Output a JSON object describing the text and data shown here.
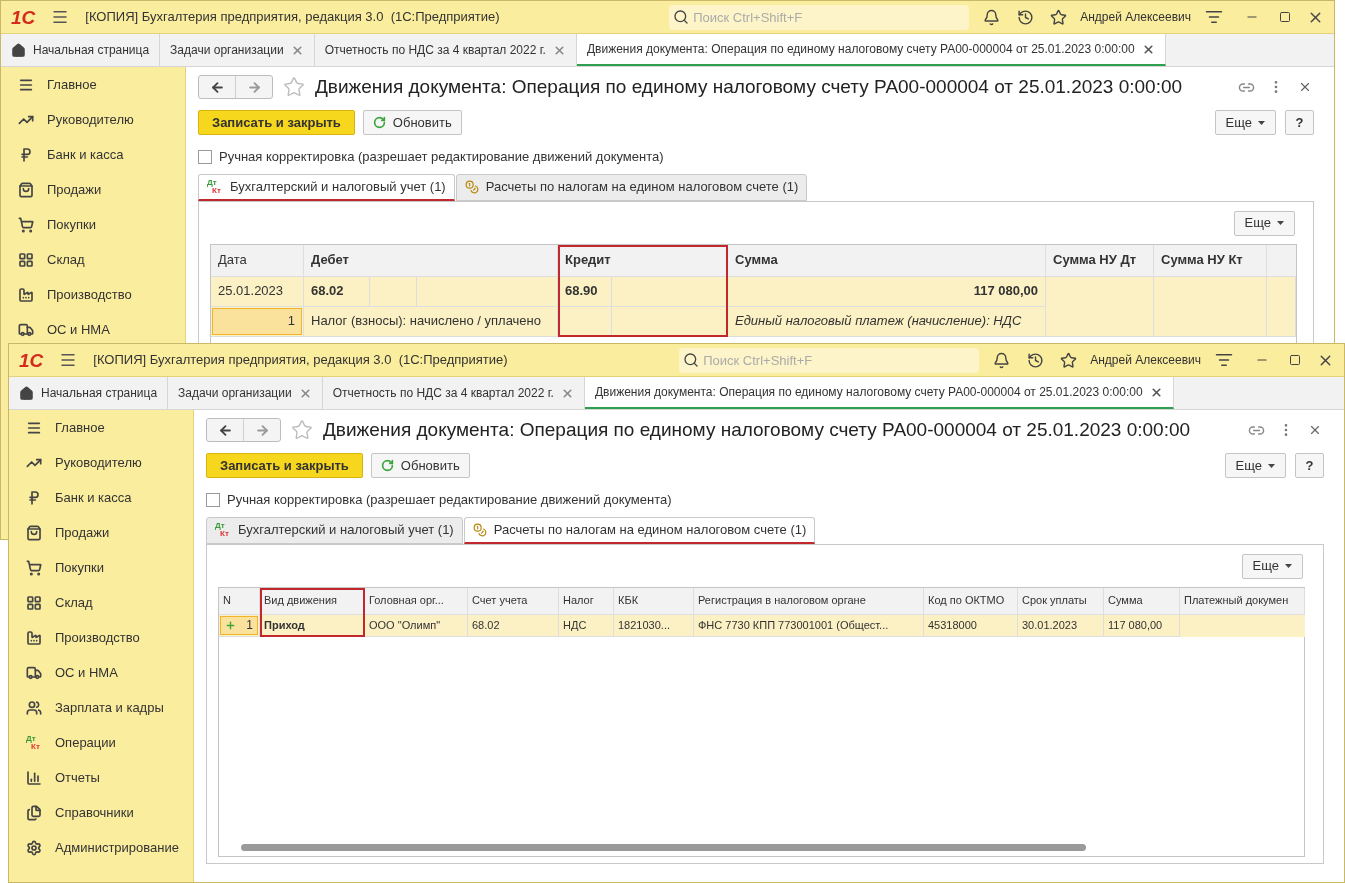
{
  "windows": [
    {
      "logo": "1С",
      "title": "[КОПИЯ] Бухгалтерия предприятия, редакция 3.0  (1С:Предприятие)",
      "search": {
        "placeholder": "Поиск Ctrl+Shift+F"
      },
      "user": "Андрей Алексеевич",
      "tabs": [
        {
          "label": "Начальная страница",
          "kind": "home",
          "selected": false
        },
        {
          "label": "Задачи организации",
          "kind": "page",
          "selected": false
        },
        {
          "label": "Отчетность по НДС за 4 квартал 2022 г.",
          "kind": "page",
          "selected": false
        },
        {
          "label": "Движения документа: Операция по единому налоговому счету РА00-000004 от 25.01.2023 0:00:00",
          "kind": "page",
          "selected": true
        }
      ],
      "sidebar": {
        "items": [
          {
            "label": "Главное"
          },
          {
            "label": "Руководителю"
          },
          {
            "label": "Банк и касса"
          },
          {
            "label": "Продажи"
          },
          {
            "label": "Покупки"
          },
          {
            "label": "Склад"
          },
          {
            "label": "Производство"
          },
          {
            "label": "ОС и НМА"
          }
        ]
      },
      "document": {
        "title": "Движения документа: Операция по единому налоговому счету РА00-000004 от 25.01.2023 0:00:00",
        "save_button": "Записать и закрыть",
        "refresh_button": "Обновить",
        "more_button": "Еще",
        "help_button": "?",
        "manual_edit": {
          "label": "Ручная корректировка (разрешает редактирование движений документа)",
          "checked": false
        },
        "tabs": [
          {
            "label": "Бухгалтерский и налоговый учет (1)",
            "icon_label": [
              "Дт",
              "Кт"
            ],
            "selected": true
          },
          {
            "label": "Расчеты по налогам на едином налоговом счете (1)",
            "selected": false
          }
        ],
        "table": {
          "kind": "entries",
          "more_button": "Еще",
          "columns": [
            {
              "label": "Дата",
              "highlighted": false
            },
            {
              "label": "Дебет",
              "highlighted": false
            },
            {
              "label": "Кредит",
              "highlighted": true
            },
            {
              "label": "Сумма",
              "highlighted": false
            },
            {
              "label": "Сумма НУ Дт",
              "highlighted": false
            },
            {
              "label": "Сумма НУ Кт",
              "highlighted": false
            }
          ],
          "rows": [
            {
              "selected": true,
              "date": "25.01.2023",
              "debit": "68.02",
              "credit": "68.90",
              "amount": "117 080,00",
              "number": "1",
              "content": "Налог (взносы): начислено / уплачено",
              "description": "Единый налоговый платеж (начисление): НДС"
            }
          ]
        }
      }
    },
    {
      "logo": "1С",
      "title": "[КОПИЯ] Бухгалтерия предприятия, редакция 3.0  (1С:Предприятие)",
      "search": {
        "placeholder": "Поиск Ctrl+Shift+F"
      },
      "user": "Андрей Алексеевич",
      "tabs": [
        {
          "label": "Начальная страница",
          "kind": "home",
          "selected": false
        },
        {
          "label": "Задачи организации",
          "kind": "page",
          "selected": false
        },
        {
          "label": "Отчетность по НДС за 4 квартал 2022 г.",
          "kind": "page",
          "selected": false
        },
        {
          "label": "Движения документа: Операция по единому налоговому счету РА00-000004 от 25.01.2023 0:00:00",
          "kind": "page",
          "selected": true
        }
      ],
      "sidebar": {
        "items": [
          {
            "label": "Главное"
          },
          {
            "label": "Руководителю"
          },
          {
            "label": "Банк и касса"
          },
          {
            "label": "Продажи"
          },
          {
            "label": "Покупки"
          },
          {
            "label": "Склад"
          },
          {
            "label": "Производство"
          },
          {
            "label": "ОС и НМА"
          },
          {
            "label": "Зарплата и кадры"
          },
          {
            "label": "Операции",
            "icon_label": [
              "Дт",
              "Кт"
            ]
          },
          {
            "label": "Отчеты"
          },
          {
            "label": "Справочники"
          },
          {
            "label": "Администрирование"
          }
        ]
      },
      "document": {
        "title": "Движения документа: Операция по единому налоговому счету РА00-000004 от 25.01.2023 0:00:00",
        "save_button": "Записать и закрыть",
        "refresh_button": "Обновить",
        "more_button": "Еще",
        "help_button": "?",
        "manual_edit": {
          "label": "Ручная корректировка (разрешает редактирование движений документа)",
          "checked": false
        },
        "tabs": [
          {
            "label": "Бухгалтерский и налоговый учет (1)",
            "icon_label": [
              "Дт",
              "Кт"
            ],
            "selected": false
          },
          {
            "label": "Расчеты по налогам на едином налоговом счете (1)",
            "selected": true
          }
        ],
        "table": {
          "kind": "register",
          "more_button": "Еще",
          "columns": [
            {
              "label": "N",
              "highlighted": false
            },
            {
              "label": "Вид движения",
              "highlighted": true
            },
            {
              "label": "Головная орг...",
              "highlighted": false
            },
            {
              "label": "Счет учета",
              "highlighted": false
            },
            {
              "label": "Налог",
              "highlighted": false
            },
            {
              "label": "КБК",
              "highlighted": false
            },
            {
              "label": "Регистрация в налоговом органе",
              "highlighted": false
            },
            {
              "label": "Код по ОКТМО",
              "highlighted": false
            },
            {
              "label": "Срок уплаты",
              "highlighted": false
            },
            {
              "label": "Сумма",
              "highlighted": false
            },
            {
              "label": "Платежный докумен",
              "highlighted": false
            }
          ],
          "rows": [
            {
              "selected": true,
              "cells": [
                "1",
                "Приход",
                "ООО \"Олимп\"",
                "68.02",
                "НДС",
                "1821030...",
                "ФНС 7730 КПП 773001001 (Общест...",
                "45318000",
                "30.01.2023",
                "117 080,00"
              ]
            }
          ]
        }
      }
    }
  ]
}
